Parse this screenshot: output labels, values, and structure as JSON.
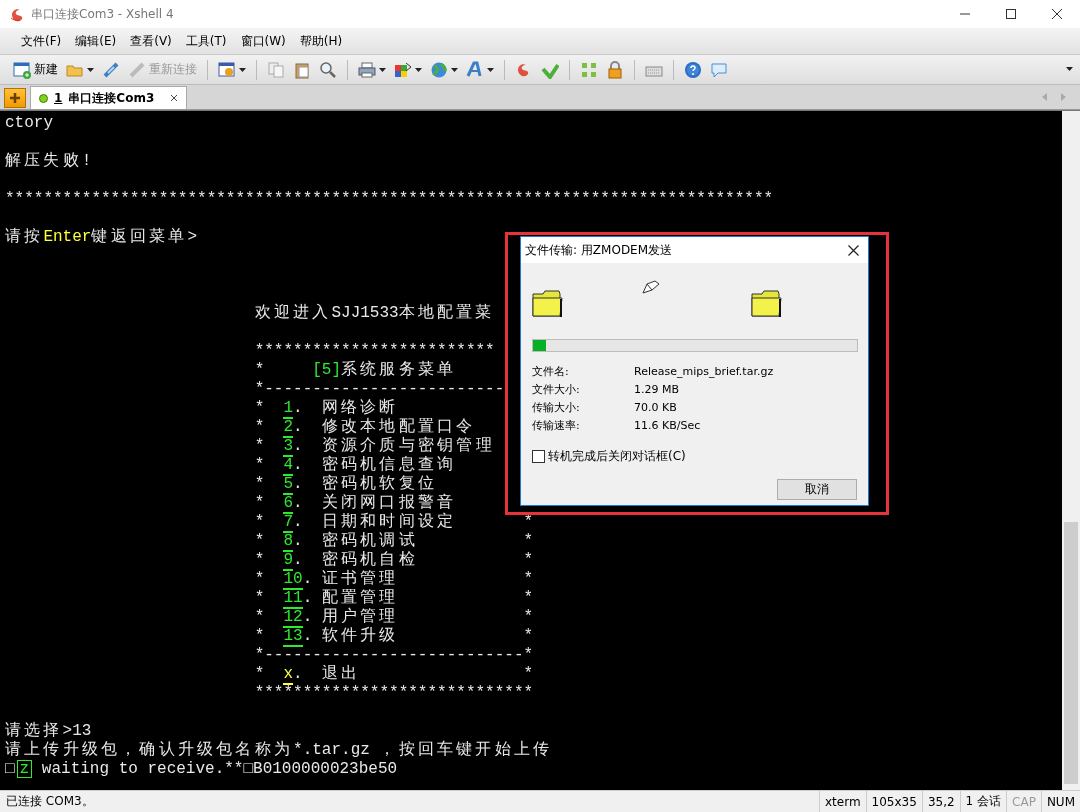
{
  "window": {
    "title": "串口连接Com3 - Xshell 4"
  },
  "menu": [
    {
      "label": "文件(F)"
    },
    {
      "label": "编辑(E)"
    },
    {
      "label": "查看(V)"
    },
    {
      "label": "工具(T)"
    },
    {
      "label": "窗口(W)"
    },
    {
      "label": "帮助(H)"
    }
  ],
  "toolbar": {
    "new_label": "新建",
    "reconnect": {
      "label": "重新连接",
      "disabled": true
    }
  },
  "tabs": [
    {
      "number": "1",
      "label": "串口连接Com3",
      "selected": true,
      "connected": true
    }
  ],
  "terminal": {
    "lines": [
      {
        "kind": "text",
        "segments": [
          {
            "kind": "plain",
            "text": "ctory"
          }
        ]
      },
      {
        "kind": "blank"
      },
      {
        "kind": "text",
        "segments": [
          {
            "kind": "plain",
            "text": "解压失败!"
          }
        ]
      },
      {
        "kind": "blank"
      },
      {
        "kind": "text",
        "segments": [
          {
            "kind": "plain",
            "text": "********************************************************************************"
          }
        ]
      },
      {
        "kind": "blank"
      },
      {
        "kind": "text",
        "segments": [
          {
            "kind": "plain",
            "text": "请按"
          },
          {
            "kind": "accent",
            "text": "Enter"
          },
          {
            "kind": "plain",
            "text": "键返回菜单>"
          }
        ]
      },
      {
        "kind": "blank"
      },
      {
        "kind": "blank"
      },
      {
        "kind": "blank"
      },
      {
        "kind": "text",
        "segments": [
          {
            "kind": "plain",
            "text": "                          欢迎进入SJJ1533本地配置菜"
          }
        ]
      },
      {
        "kind": "blank"
      },
      {
        "kind": "text",
        "segments": [
          {
            "kind": "plain",
            "text": "                          *************************"
          }
        ]
      },
      {
        "kind": "text",
        "segments": [
          {
            "kind": "plain",
            "text": "                          *     "
          },
          {
            "kind": "label",
            "text": "[5]"
          },
          {
            "kind": "plain",
            "text": "系统服务菜单"
          }
        ]
      },
      {
        "kind": "text",
        "segments": [
          {
            "kind": "plain",
            "text": "                          *-------------------------"
          }
        ]
      },
      {
        "kind": "text",
        "segments": [
          {
            "kind": "plain",
            "text": "                          *  "
          },
          {
            "kind": "option",
            "text": "1"
          },
          {
            "kind": "plain",
            "text": ".  网络诊断"
          }
        ]
      },
      {
        "kind": "text",
        "segments": [
          {
            "kind": "plain",
            "text": "                          *  "
          },
          {
            "kind": "option",
            "text": "2"
          },
          {
            "kind": "plain",
            "text": ".  修改本地配置口令"
          }
        ]
      },
      {
        "kind": "text",
        "segments": [
          {
            "kind": "plain",
            "text": "                          *  "
          },
          {
            "kind": "option",
            "text": "3"
          },
          {
            "kind": "plain",
            "text": ".  资源介质与密钥管理"
          }
        ]
      },
      {
        "kind": "text",
        "segments": [
          {
            "kind": "plain",
            "text": "                          *  "
          },
          {
            "kind": "option",
            "text": "4"
          },
          {
            "kind": "plain",
            "text": ".  密码机信息查询"
          }
        ]
      },
      {
        "kind": "text",
        "segments": [
          {
            "kind": "plain",
            "text": "                          *  "
          },
          {
            "kind": "option",
            "text": "5"
          },
          {
            "kind": "plain",
            "text": ".  密码机软复位"
          }
        ]
      },
      {
        "kind": "text",
        "segments": [
          {
            "kind": "plain",
            "text": "                          *  "
          },
          {
            "kind": "option",
            "text": "6"
          },
          {
            "kind": "plain",
            "text": ".  关闭网口报警音"
          }
        ]
      },
      {
        "kind": "text",
        "segments": [
          {
            "kind": "plain",
            "text": "                          *  "
          },
          {
            "kind": "option",
            "text": "7"
          },
          {
            "kind": "plain",
            "text": ".  日期和时间设定"
          },
          {
            "kind": "plain",
            "text": "       *"
          }
        ]
      },
      {
        "kind": "text",
        "segments": [
          {
            "kind": "plain",
            "text": "                          *  "
          },
          {
            "kind": "option",
            "text": "8"
          },
          {
            "kind": "plain",
            "text": ".  密码机调试"
          },
          {
            "kind": "plain",
            "text": "           *"
          }
        ]
      },
      {
        "kind": "text",
        "segments": [
          {
            "kind": "plain",
            "text": "                          *  "
          },
          {
            "kind": "option",
            "text": "9"
          },
          {
            "kind": "plain",
            "text": ".  密码机自检"
          },
          {
            "kind": "plain",
            "text": "           *"
          }
        ]
      },
      {
        "kind": "text",
        "segments": [
          {
            "kind": "plain",
            "text": "                          *  "
          },
          {
            "kind": "option",
            "text": "10"
          },
          {
            "kind": "plain",
            "text": ". 证书管理"
          },
          {
            "kind": "plain",
            "text": "             *"
          }
        ]
      },
      {
        "kind": "text",
        "segments": [
          {
            "kind": "plain",
            "text": "                          *  "
          },
          {
            "kind": "option",
            "text": "11"
          },
          {
            "kind": "plain",
            "text": ". 配置管理"
          },
          {
            "kind": "plain",
            "text": "             *"
          }
        ]
      },
      {
        "kind": "text",
        "segments": [
          {
            "kind": "plain",
            "text": "                          *  "
          },
          {
            "kind": "option",
            "text": "12"
          },
          {
            "kind": "plain",
            "text": ". 用户管理"
          },
          {
            "kind": "plain",
            "text": "             *"
          }
        ]
      },
      {
        "kind": "text",
        "segments": [
          {
            "kind": "plain",
            "text": "                          *  "
          },
          {
            "kind": "option",
            "text": "13"
          },
          {
            "kind": "plain",
            "text": ". 软件升级"
          },
          {
            "kind": "plain",
            "text": "             *"
          }
        ]
      },
      {
        "kind": "text",
        "segments": [
          {
            "kind": "plain",
            "text": "                          *---------------------------*"
          }
        ]
      },
      {
        "kind": "text",
        "segments": [
          {
            "kind": "plain",
            "text": "                          *  "
          },
          {
            "kind": "exit",
            "text": "x"
          },
          {
            "kind": "plain",
            "text": ".  退出"
          },
          {
            "kind": "plain",
            "text": "                 *"
          }
        ]
      },
      {
        "kind": "text",
        "segments": [
          {
            "kind": "plain",
            "text": "                          *****************************"
          }
        ]
      },
      {
        "kind": "blank"
      },
      {
        "kind": "text",
        "segments": [
          {
            "kind": "plain",
            "text": "请选择>13"
          }
        ]
      },
      {
        "kind": "text",
        "segments": [
          {
            "kind": "plain",
            "text": "请上传升级包，确认升级包名称为*.tar.gz ，按回车键开始上传"
          }
        ]
      },
      {
        "kind": "text",
        "segments": [
          {
            "kind": "plain",
            "text": "□"
          },
          {
            "kind": "cursor",
            "text": "z"
          },
          {
            "kind": "plain",
            "text": " waiting to receive.**□B0100000023be50"
          }
        ]
      }
    ]
  },
  "dialog": {
    "title": "文件传输: 用ZMODEM发送",
    "progress": {
      "level": 0.04
    },
    "fields": [
      {
        "label": "文件名:",
        "value": "Release_mips_brief.tar.gz"
      },
      {
        "label": "文件大小:",
        "value": "1.29 MB"
      },
      {
        "label": "传输大小:",
        "value": "70.0 KB"
      },
      {
        "label": "传输速率:",
        "value": "11.6 KB/Sec"
      }
    ],
    "close_option": {
      "label": "转机完成后关闭对话框(C)",
      "checked": false
    },
    "cancel_button": "取消"
  },
  "status_bar": {
    "message": "已连接 COM3。",
    "cells": [
      {
        "text": "xterm"
      },
      {
        "text": "105x35"
      },
      {
        "text": "35,2"
      },
      {
        "text": "1 会话"
      }
    ],
    "indicators": [
      {
        "text": "CAP",
        "on": false
      },
      {
        "text": "NUM",
        "on": true
      }
    ]
  }
}
